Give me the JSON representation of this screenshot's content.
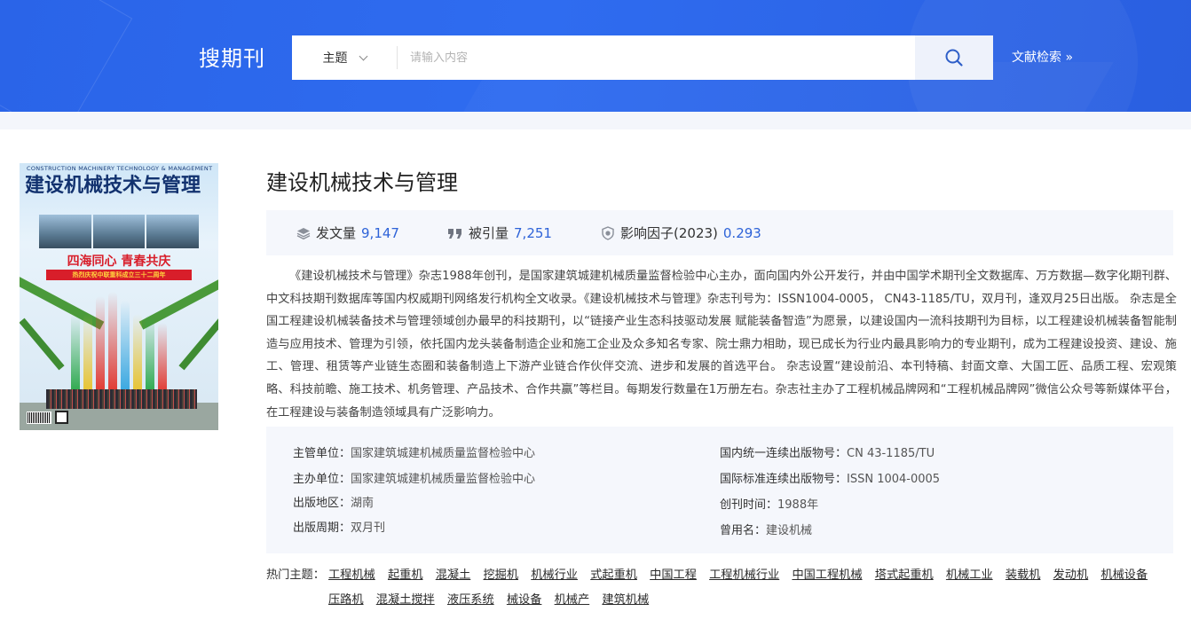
{
  "header": {
    "logo": "搜期刊",
    "search": {
      "type_label": "主题",
      "placeholder": "请输入内容"
    },
    "advanced_link": "文献检索 »"
  },
  "journal": {
    "title": "建设机械技术与管理",
    "cover": {
      "en_title": "CONSTRUCTION MACHINERY TECHNOLOGY & MANAGEMENT",
      "cn_title": "建设机械技术与管理",
      "slogan": "四海同心 青春共庆",
      "ribbon": "热烈庆祝中联重科成立三十二周年"
    },
    "stats": {
      "articles_label": "发文量",
      "articles_value": "9,147",
      "citations_label": "被引量",
      "citations_value": "7,251",
      "impact_label": "影响因子(2023)",
      "impact_value": "0.293"
    },
    "description": "《建设机械技术与管理》杂志1988年创刊，是国家建筑城建机械质量监督检验中心主办，面向国内外公开发行，并由中国学术期刊全文数据库、万方数据—数字化期刊群、中文科技期刊数据库等国内权威期刊网络发行机构全文收录。《建设机械技术与管理》杂志刊号为：ISSN1004-0005， CN43-1185/TU，双月刊，逢双月25日出版。 杂志是全国工程建设机械装备技术与管理领域创办最早的科技期刊，以“链接产业生态科技驱动发展 赋能装备智造”为愿景，以建设国内一流科技期刊为目标，以工程建设机械装备智能制造与应用技术、管理为引领，依托国内龙头装备制造企业和施工企业及众多知名专家、院士鼎力相助，现已成长为行业内最具影响力的专业期刊，成为工程建设投资、建设、施工、管理、租赁等产业链生态圈和装备制造上下游产业链合作伙伴交流、进步和发展的首选平台。 杂志设置“建设前沿、本刊特稿、封面文章、大国工匠、品质工程、宏观策略、科技前瞻、施工技术、机务管理、产品技术、合作共赢”等栏目。每期发行数量在1万册左右。杂志社主办了工程机械品牌网和“工程机械品牌网”微信公众号等新媒体平台，在工程建设与装备制造领域具有广泛影响力。",
    "meta": {
      "supervisor_label": "主管单位：",
      "supervisor": "国家建筑城建机械质量监督检验中心",
      "sponsor_label": "主办单位：",
      "sponsor": "国家建筑城建机械质量监督检验中心",
      "region_label": "出版地区：",
      "region": "湖南",
      "cycle_label": "出版周期：",
      "cycle": "双月刊",
      "cn_label": "国内统一连续出版物号：",
      "cn": "CN 43-1185/TU",
      "issn_label": "国际标准连续出版物号：",
      "issn": "ISSN 1004-0005",
      "founded_label": "创刊时间：",
      "founded": "1988年",
      "former_label": "曾用名：",
      "former": "建设机械"
    },
    "hot_topics_label": "热门主题：",
    "hot_topics": [
      "工程机械",
      "起重机",
      "混凝土",
      "挖掘机",
      "机械行业",
      "式起重机",
      "中国工程",
      "工程机械行业",
      "中国工程机械",
      "塔式起重机",
      "机械工业",
      "装载机",
      "发动机",
      "机械设备",
      "压路机",
      "混凝土搅拌",
      "液压系统",
      "械设备",
      "机械产",
      "建筑机械"
    ]
  },
  "colors": {
    "header_blue": "#2f6cf0",
    "accent_number": "#2e63d8",
    "panel_bg": "#f5f7fc"
  }
}
